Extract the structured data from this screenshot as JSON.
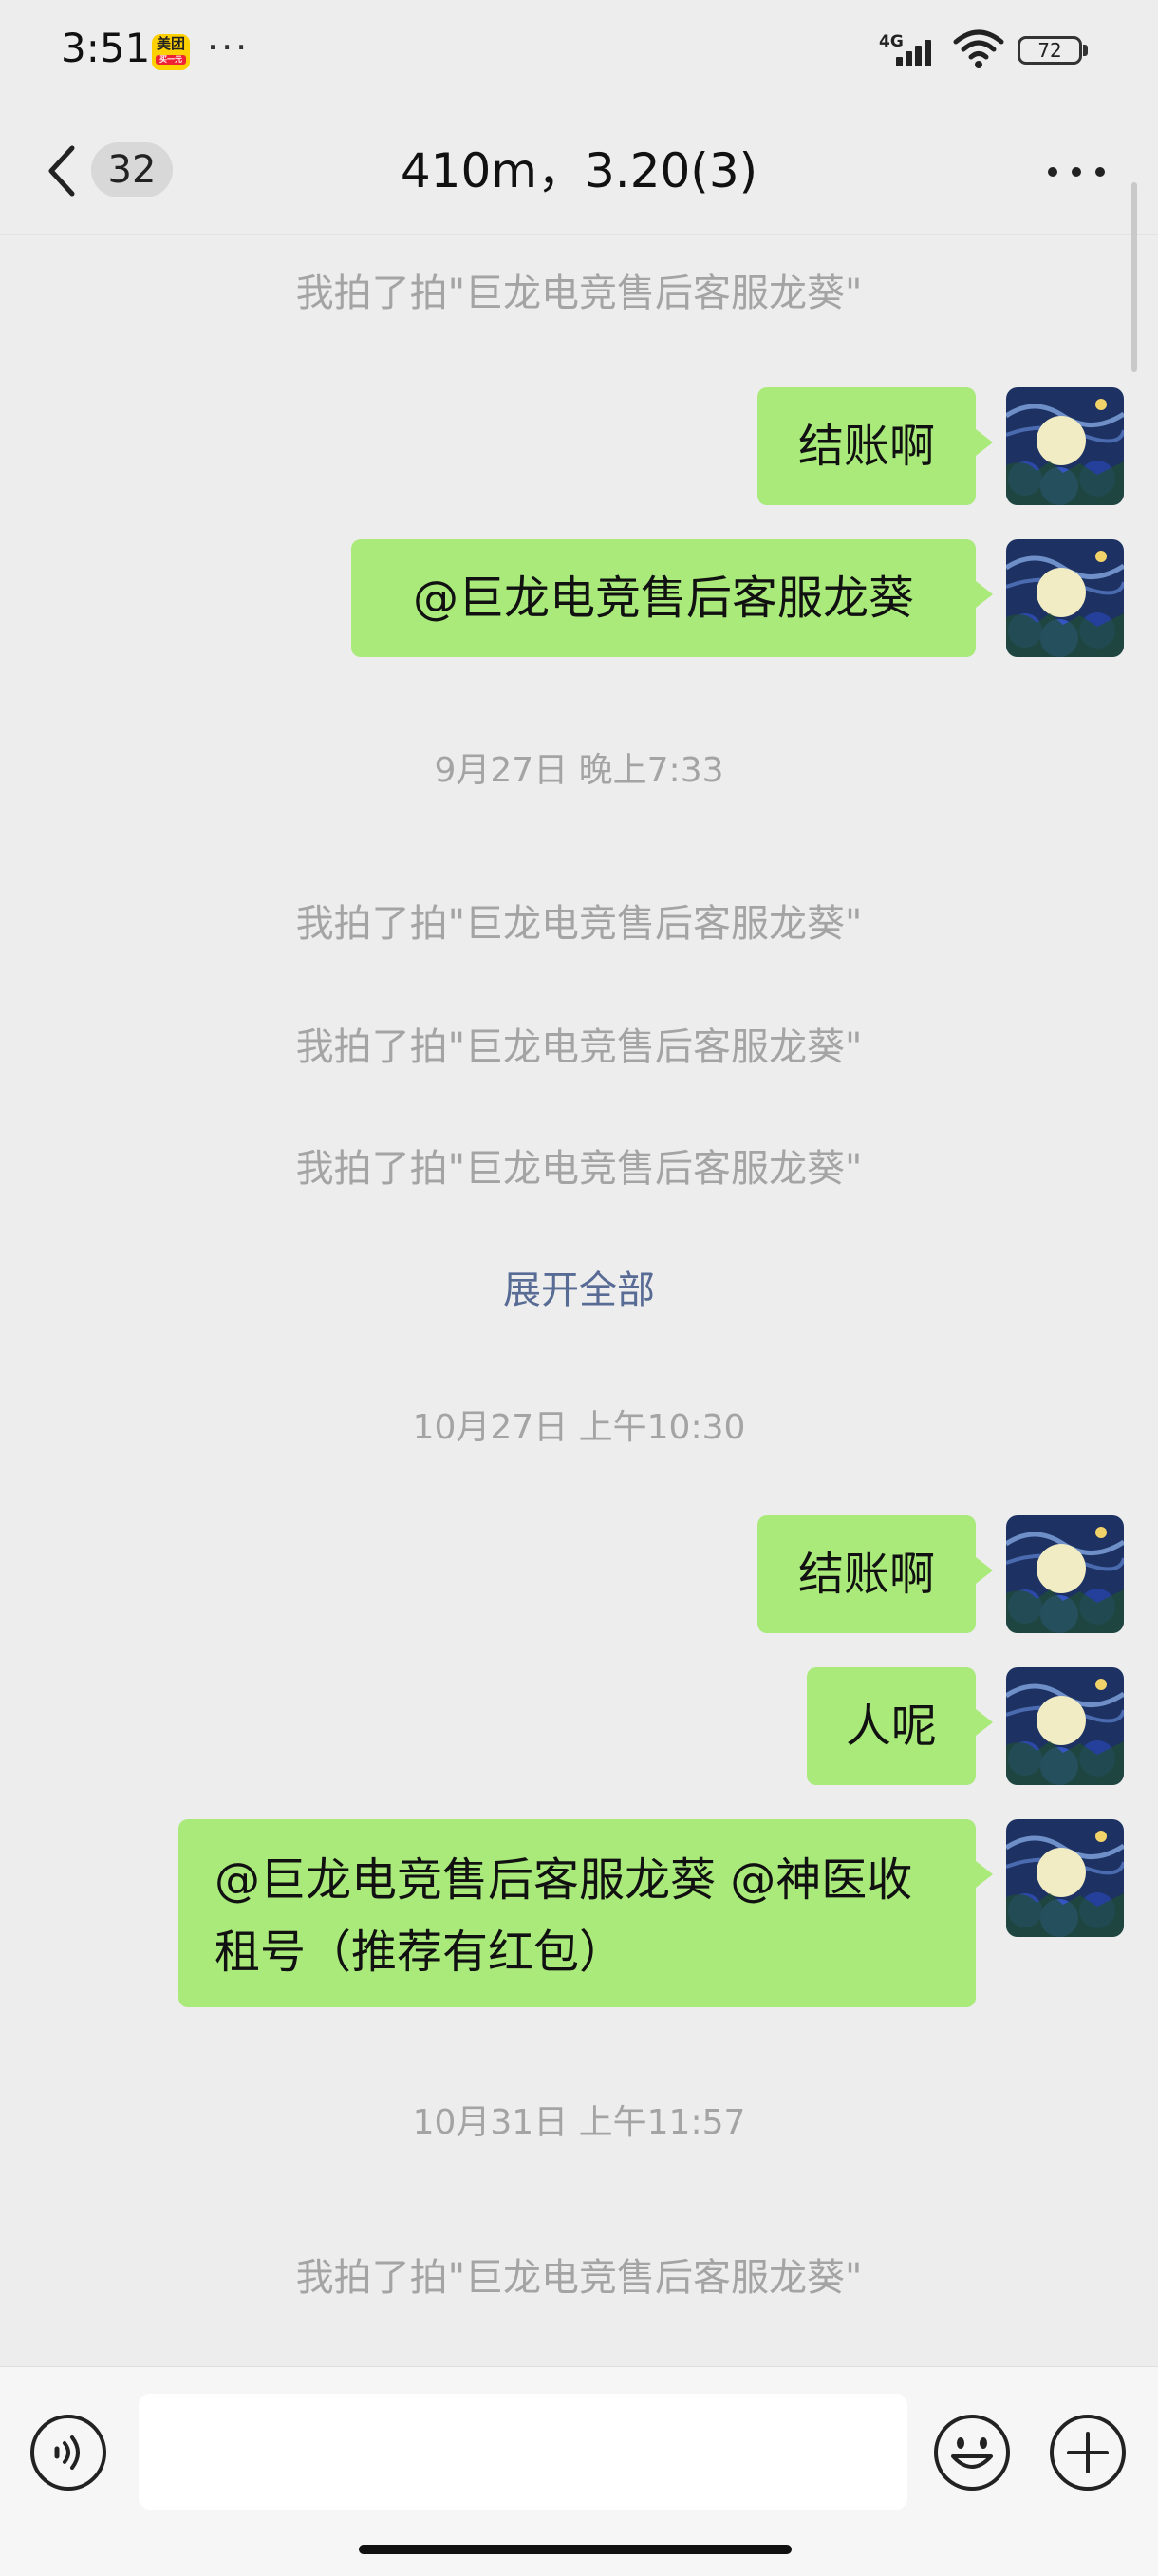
{
  "status_bar": {
    "time": "3:51",
    "app_badge": "美团",
    "app_badge_sub": "买一元",
    "more_dots": "···",
    "network": "4G",
    "battery": "72"
  },
  "header": {
    "unread_count": "32",
    "title": "410m，3.20(3)"
  },
  "messages": [
    {
      "type": "system",
      "text": "我拍了拍\"巨龙电竞售后客服龙葵\""
    },
    {
      "type": "sent",
      "text": "结账啊"
    },
    {
      "type": "sent",
      "text": "@巨龙电竞售后客服龙葵"
    },
    {
      "type": "time",
      "text": "9月27日 晚上7:33"
    },
    {
      "type": "system",
      "text": "我拍了拍\"巨龙电竞售后客服龙葵\""
    },
    {
      "type": "system",
      "text": "我拍了拍\"巨龙电竞售后客服龙葵\""
    },
    {
      "type": "system",
      "text": "我拍了拍\"巨龙电竞售后客服龙葵\""
    },
    {
      "type": "link",
      "text": "展开全部"
    },
    {
      "type": "time",
      "text": "10月27日 上午10:30"
    },
    {
      "type": "sent",
      "text": "结账啊"
    },
    {
      "type": "sent",
      "text": "人呢"
    },
    {
      "type": "sent",
      "text": "@巨龙电竞售后客服龙葵 @神医收租号（推荐有红包）"
    },
    {
      "type": "time",
      "text": "10月31日 上午11:57"
    },
    {
      "type": "system",
      "text": "我拍了拍\"巨龙电竞售后客服龙葵\""
    }
  ],
  "input": {
    "placeholder": ""
  },
  "icons": {
    "back": "chevron-left-icon",
    "more": "more-horizontal-icon",
    "voice": "voice-icon",
    "emoji": "emoji-icon",
    "add": "plus-icon"
  },
  "colors": {
    "background": "#ededed",
    "bubble_sent": "#a9ea7a",
    "link": "#576b95",
    "system_text": "#a4a4a4"
  }
}
